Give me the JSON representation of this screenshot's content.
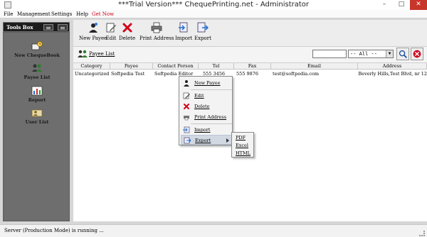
{
  "window": {
    "title": "***Trial Version*** ChequePrinting.net - Administrator"
  },
  "menu": {
    "file": "File",
    "management": "Management",
    "settings": "Settings",
    "help": "Help",
    "get_now": "Get Now"
  },
  "toolsbox": {
    "title": "Tools Box"
  },
  "sidebar": {
    "items": [
      {
        "label": "New ChequeBook",
        "icon": "chequebook-clock-icon"
      },
      {
        "label": "Payee List",
        "icon": "people-icon"
      },
      {
        "label": "Report",
        "icon": "chart-icon"
      },
      {
        "label": "User List",
        "icon": "user-list-icon"
      }
    ]
  },
  "toolbar": {
    "new_payee": "New Payee",
    "edit": "Edit",
    "delete": "Delete",
    "print_address": "Print Address",
    "import": "Import",
    "export": "Export"
  },
  "subbar": {
    "payee_list": "Payee List",
    "search_value": "",
    "filter": "-- All --"
  },
  "grid": {
    "columns": [
      "Category",
      "Payee",
      "Contact Person",
      "Tel",
      "Fax",
      "Email",
      "Address"
    ],
    "rows": [
      {
        "category": "Uncategorized",
        "payee": "Softpedia Test",
        "contact": "Softpedia Editor",
        "tel": "555 3456",
        "fax": "555 9876",
        "email": "test@softpedia.com",
        "address": "Beverly Hills,Test Blvd, nr 12"
      }
    ]
  },
  "context_menu": {
    "items": [
      {
        "label": "New Payee",
        "icon": "new-payee-icon"
      },
      {
        "label": "Edit",
        "icon": "edit-icon"
      },
      {
        "label": "Delete",
        "icon": "delete-icon"
      },
      {
        "label": "Print Address",
        "icon": "printer-icon"
      },
      {
        "label": "Import",
        "icon": "import-icon"
      },
      {
        "label": "Export",
        "icon": "export-icon"
      }
    ],
    "export_submenu": [
      "PDF",
      "Excel",
      "HTML"
    ]
  },
  "status": {
    "text": "Server (Production Mode) is running ..."
  },
  "colors": {
    "get_now": "#d0021b",
    "toolsbox_header": "#1c1c1c",
    "sidebar": "#6e6e6e",
    "delete_red": "#d0021b"
  }
}
